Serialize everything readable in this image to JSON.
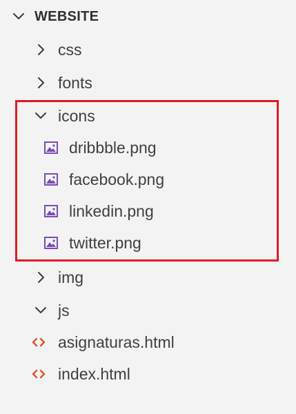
{
  "explorer": {
    "section_title": "WEBSITE",
    "items": [
      {
        "label": "css",
        "kind": "folder",
        "state": "collapsed"
      },
      {
        "label": "fonts",
        "kind": "folder",
        "state": "collapsed"
      },
      {
        "label": "icons",
        "kind": "folder",
        "state": "expanded"
      },
      {
        "label": "dribbble.png",
        "kind": "image"
      },
      {
        "label": "facebook.png",
        "kind": "image"
      },
      {
        "label": "linkedin.png",
        "kind": "image"
      },
      {
        "label": "twitter.png",
        "kind": "image"
      },
      {
        "label": "img",
        "kind": "folder",
        "state": "collapsed"
      },
      {
        "label": "js",
        "kind": "folder",
        "state": "expanded"
      },
      {
        "label": "asignaturas.html",
        "kind": "html"
      },
      {
        "label": "index.html",
        "kind": "html"
      }
    ]
  },
  "colors": {
    "background": "#f3f3f3",
    "highlight_border": "#e01b24",
    "image_icon": "#7a4bb3",
    "html_icon": "#e0502a"
  },
  "icons": {
    "collapsed": "chevron-right-icon",
    "expanded": "chevron-down-icon",
    "image": "image-file-icon",
    "html": "html-file-icon"
  }
}
